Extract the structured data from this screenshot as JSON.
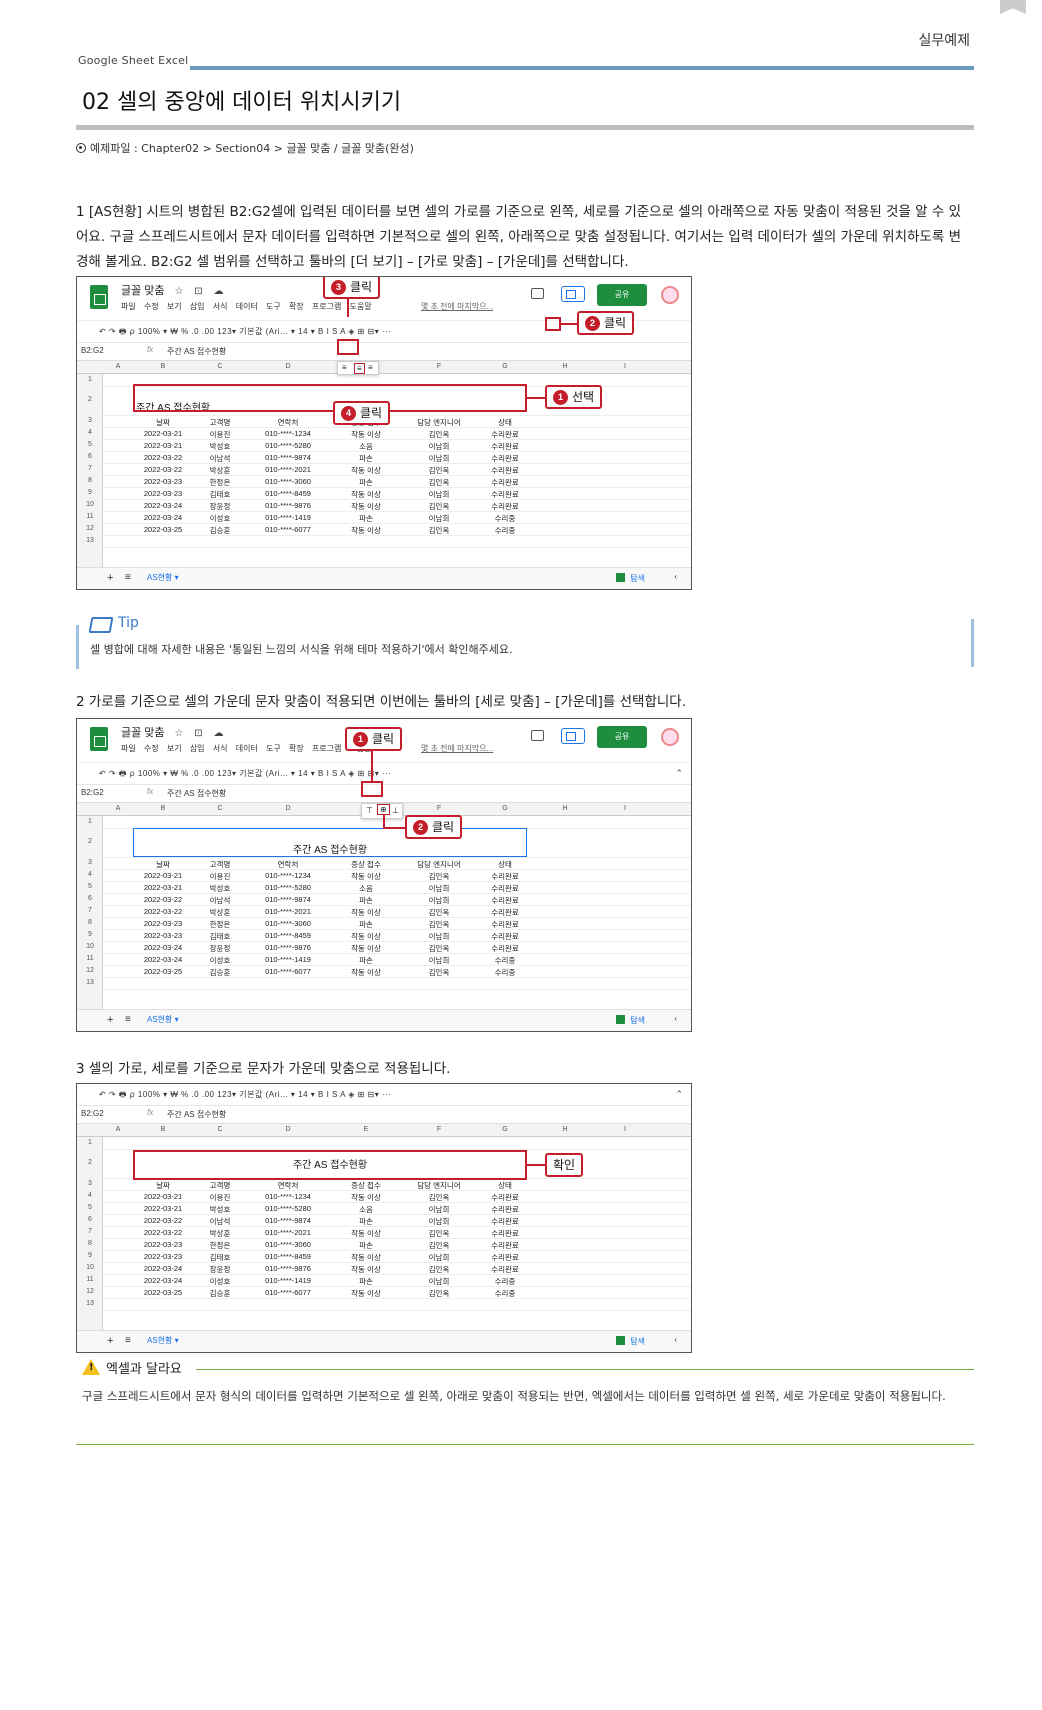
{
  "header": {
    "page_label": "실무예제",
    "brand": "Google Sheet  Excel"
  },
  "title": "02 셀의 중앙에 데이터 위치시키기",
  "sample_file": "예제파일 : Chapter02 > Section04 > 글꼴 맞춤 / 글꼴 맞춤(완성)",
  "steps": {
    "s1": "1 [AS현황] 시트의 병합된 B2:G2셀에 입력된 데이터를 보면 셀의 가로를 기준으로 왼쪽, 세로를 기준으로 셀의 아래쪽으로 자동 맞춤이 적용된 것을 알 수 있어요. 구글 스프레드시트에서 문자 데이터를 입력하면 기본적으로 셀의 왼쪽, 아래쪽으로 맞춤 설정됩니다. 여기서는 입력 데이터가 셀의 가운데 위치하도록 변경해 볼게요. B2:G2 셀 범위를 선택하고 툴바의 [더 보기] – [가로 맞춤] – [가운데]를 선택합니다.",
    "s2": "2 가로를 기준으로 셀의 가운데 문자 맞춤이 적용되면 이번에는 툴바의 [세로 맞춤] – [가운데]를 선택합니다.",
    "s3": "3 셀의 가로, 세로를 기준으로 문자가 가운데 맞춤으로 적용됩니다."
  },
  "app": {
    "doc_title": "글꼴 맞춤",
    "menu": "파일 수정 보기 삽입 서식 데이터 도구 확장 프로그램 도움말",
    "last_edit": "몇 초 전에 마지막으...",
    "share": "공유",
    "toolbar": "↶ ↷ 🖶 ⍴  100% ▾  ₩ % .0 .00 123▾  기본값 (Ari... ▾  14 ▾  B I S A  ◈ ⊞ ⊟▾  ···",
    "cell_ref": "B2:G2",
    "fx": "fx",
    "formula_value": "주간 AS 접수현황",
    "sheet_tab": "AS현황 ▾",
    "explore": "탐색"
  },
  "table": {
    "columns": [
      "A",
      "B",
      "C",
      "D",
      "E",
      "F",
      "G",
      "H",
      "I"
    ],
    "rows": [
      "1",
      "2",
      "3",
      "4",
      "5",
      "6",
      "7",
      "8",
      "9",
      "10",
      "11",
      "12",
      "13"
    ],
    "merged_title": "주간 AS 접수현황",
    "headers": [
      "날짜",
      "고객명",
      "연락처",
      "증상 접수",
      "담당 엔지니어",
      "상태"
    ],
    "data": [
      [
        "2022-03-21",
        "이용진",
        "010-****-1234",
        "작동 이상",
        "김인옥",
        "수리완료"
      ],
      [
        "2022-03-21",
        "박성호",
        "010-****-5280",
        "소음",
        "이남희",
        "수리완료"
      ],
      [
        "2022-03-22",
        "이남석",
        "010-****-9874",
        "파손",
        "이남희",
        "수리완료"
      ],
      [
        "2022-03-22",
        "박상훈",
        "010-****-2021",
        "작동 이상",
        "김인옥",
        "수리완료"
      ],
      [
        "2022-03-23",
        "한정은",
        "010-****-3060",
        "파손",
        "김인옥",
        "수리완료"
      ],
      [
        "2022-03-23",
        "김태호",
        "010-****-8459",
        "작동 이상",
        "이남희",
        "수리완료"
      ],
      [
        "2022-03-24",
        "장윤정",
        "010-****-9876",
        "작동 이상",
        "김인옥",
        "수리완료"
      ],
      [
        "2022-03-24",
        "이성호",
        "010-****-1419",
        "파손",
        "이남희",
        "수리중"
      ],
      [
        "2022-03-25",
        "김승훈",
        "010-****-6077",
        "작동 이상",
        "김인옥",
        "수리중"
      ]
    ]
  },
  "callouts": {
    "shot1": {
      "c1": "선택",
      "c2": "클릭",
      "c3": "클릭",
      "c4": "클릭",
      "n1": "1",
      "n2": "2",
      "n3": "3",
      "n4": "4"
    },
    "shot2": {
      "c1": "클릭",
      "c2": "클릭",
      "n1": "1",
      "n2": "2"
    },
    "shot3": {
      "c1": "확인"
    }
  },
  "tip": {
    "title": "Tip",
    "text": "셀 병합에 대해 자세한 내용은 '통일된 느낌의 서식을 위해 테마 적용하기'에서 확인해주세요."
  },
  "excel_diff": {
    "title": "엑셀과 달라요",
    "text": "구글 스프레드시트에서 문자 형식의 데이터를 입력하면 기본적으로 셀 왼쪽, 아래로 맞춤이 적용되는 반면, 엑셀에서는 데이터를 입력하면 셀 왼쪽, 세로 가운데로 맞춤이 적용됩니다."
  }
}
